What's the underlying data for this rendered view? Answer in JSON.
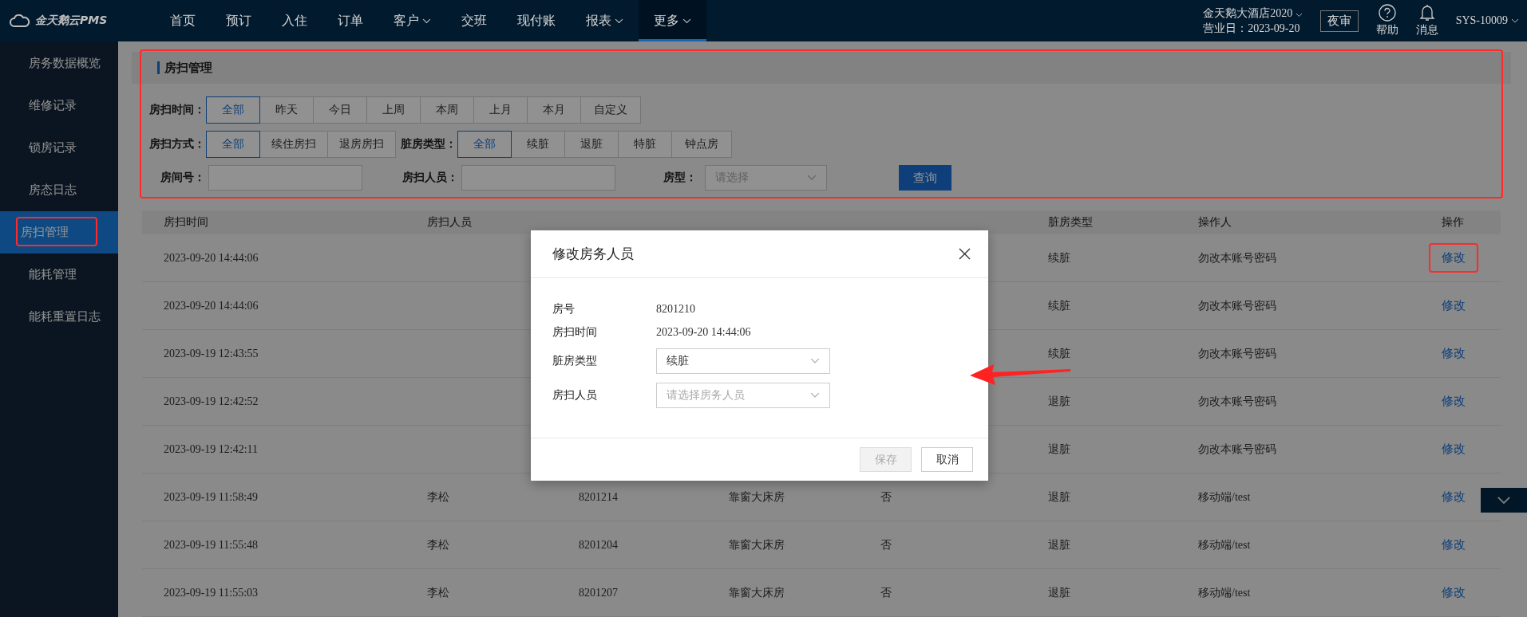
{
  "topbar": {
    "logo": "金天鹅云PMS",
    "nav": [
      {
        "label": "首页",
        "selected": false,
        "dropdown": false
      },
      {
        "label": "预订",
        "selected": false,
        "dropdown": false
      },
      {
        "label": "入住",
        "selected": false,
        "dropdown": false
      },
      {
        "label": "订单",
        "selected": false,
        "dropdown": false
      },
      {
        "label": "客户",
        "selected": false,
        "dropdown": true
      },
      {
        "label": "交班",
        "selected": false,
        "dropdown": false
      },
      {
        "label": "现付账",
        "selected": false,
        "dropdown": false
      },
      {
        "label": "报表",
        "selected": false,
        "dropdown": true
      },
      {
        "label": "更多",
        "selected": true,
        "dropdown": true
      }
    ],
    "hotel": "金天鹅大酒店2020",
    "business_day": "营业日：2023-09-20",
    "night_audit": "夜审",
    "help": "帮助",
    "messages": "消息",
    "user": "SYS-10009"
  },
  "sidebar": {
    "items": [
      {
        "label": "房务数据概览",
        "selected": false,
        "highlighted": false
      },
      {
        "label": "维修记录",
        "selected": false,
        "highlighted": false
      },
      {
        "label": "锁房记录",
        "selected": false,
        "highlighted": false
      },
      {
        "label": "房态日志",
        "selected": false,
        "highlighted": false
      },
      {
        "label": "房扫管理",
        "selected": true,
        "highlighted": true
      },
      {
        "label": "能耗管理",
        "selected": false,
        "highlighted": false
      },
      {
        "label": "能耗重置日志",
        "selected": false,
        "highlighted": false
      }
    ]
  },
  "filter": {
    "title": "房扫管理",
    "highlighted": true,
    "groups": [
      {
        "label": "房扫时间：",
        "options": [
          {
            "label": "全部",
            "selected": true
          },
          {
            "label": "昨天",
            "selected": false
          },
          {
            "label": "今日",
            "selected": false
          },
          {
            "label": "上周",
            "selected": false
          },
          {
            "label": "本周",
            "selected": false
          },
          {
            "label": "上月",
            "selected": false
          },
          {
            "label": "本月",
            "selected": false
          },
          {
            "label": "自定义",
            "selected": false
          }
        ]
      },
      {
        "label": "房扫方式：",
        "options": [
          {
            "label": "全部",
            "selected": true
          },
          {
            "label": "续住房扫",
            "selected": false
          },
          {
            "label": "退房房扫",
            "selected": false
          }
        ]
      },
      {
        "label": "脏房类型：",
        "options": [
          {
            "label": "全部",
            "selected": true
          },
          {
            "label": "续脏",
            "selected": false
          },
          {
            "label": "退脏",
            "selected": false
          },
          {
            "label": "特脏",
            "selected": false
          },
          {
            "label": "钟点房",
            "selected": false
          }
        ]
      }
    ],
    "fields": [
      {
        "label": "房间号：",
        "kind": "text"
      },
      {
        "label": "房扫人员：",
        "kind": "text"
      },
      {
        "label": "房型：",
        "kind": "select",
        "placeholder": "请选择"
      }
    ],
    "search_button": "查询"
  },
  "table": {
    "columns": [
      "房扫时间",
      "房扫人员",
      null,
      null,
      null,
      "脏房类型",
      "操作人",
      "操作"
    ],
    "rows": [
      {
        "time": "2023-09-20 14:44:06",
        "dirty_type": "续脏",
        "operator": "勿改本账号密码",
        "action": "修改",
        "highlighted": true
      },
      {
        "time": "2023-09-20 14:44:06",
        "dirty_type": "续脏",
        "operator": "勿改本账号密码",
        "action": "修改",
        "highlighted": false
      },
      {
        "time": "2023-09-19 12:43:55",
        "dirty_type": "续脏",
        "operator": "勿改本账号密码",
        "action": "修改",
        "highlighted": false
      },
      {
        "time": "2023-09-19 12:42:52",
        "dirty_type": "退脏",
        "operator": "勿改本账号密码",
        "action": "修改",
        "highlighted": false
      },
      {
        "time": "2023-09-19 12:42:11",
        "dirty_type": "退脏",
        "operator": "勿改本账号密码",
        "action": "修改",
        "highlighted": false
      },
      {
        "time": "2023-09-19 11:58:49",
        "cleaner": "李松",
        "room": "8201214",
        "room_type": "靠窗大床房",
        "renew": "否",
        "dirty_type": "退脏",
        "operator": "移动端/test",
        "action": "修改",
        "highlighted": false
      },
      {
        "time": "2023-09-19 11:55:48",
        "cleaner": "李松",
        "room": "8201204",
        "room_type": "靠窗大床房",
        "renew": "否",
        "dirty_type": "退脏",
        "operator": "移动端/test",
        "action": "修改",
        "highlighted": false
      },
      {
        "time": "2023-09-19 11:55:03",
        "cleaner": "李松",
        "room": "8201207",
        "room_type": "靠窗大床房",
        "renew": "否",
        "dirty_type": "退脏",
        "operator": "移动端/test",
        "action": "修改",
        "highlighted": false
      }
    ]
  },
  "modal": {
    "title": "修改房务人员",
    "fields": [
      {
        "label": "房号",
        "kind": "text",
        "value": "8201210"
      },
      {
        "label": "房扫时间",
        "kind": "text",
        "value": "2023-09-20 14:44:06"
      },
      {
        "label": "脏房类型",
        "kind": "select",
        "value": "续脏"
      },
      {
        "label": "房扫人员",
        "kind": "select",
        "placeholder": "请选择房务人员"
      }
    ],
    "buttons": [
      {
        "label": "保存",
        "disabled": true
      },
      {
        "label": "取消",
        "disabled": false
      }
    ]
  },
  "annotations": {
    "arrow": true
  }
}
